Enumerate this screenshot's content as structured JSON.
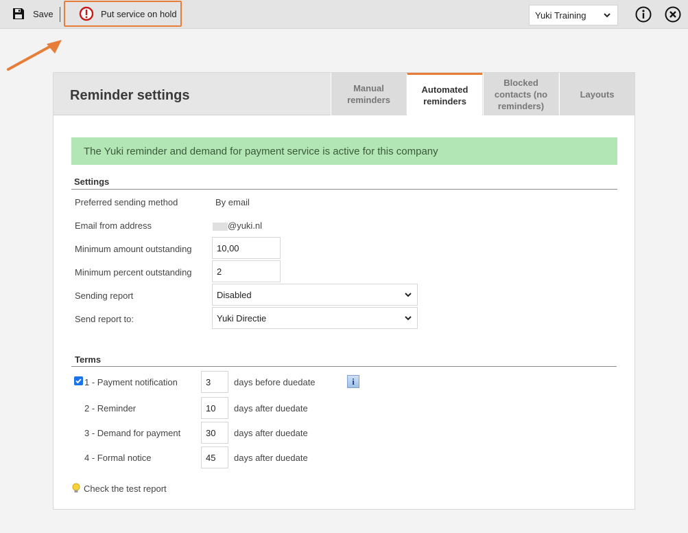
{
  "toolbar": {
    "save_label": "Save",
    "hold_label": "Put service on hold",
    "company": "Yuki Training",
    "accent_color": "#e67e3a"
  },
  "panel": {
    "title": "Reminder settings",
    "tabs": [
      {
        "label": "Manual reminders",
        "active": false
      },
      {
        "label": "Automated reminders",
        "active": true
      },
      {
        "label": "Blocked contacts (no reminders)",
        "active": false
      },
      {
        "label": "Layouts",
        "active": false
      }
    ],
    "status_banner": "The Yuki reminder and demand for payment service is active for this company"
  },
  "settings": {
    "section_title": "Settings",
    "preferred_sending_method_label": "Preferred sending method",
    "preferred_sending_method_value": "By email",
    "email_from_label": "Email from address",
    "email_from_value": "@yuki.nl",
    "min_amount_label": "Minimum amount outstanding",
    "min_amount_value": "10,00",
    "min_percent_label": "Minimum percent outstanding",
    "min_percent_value": "2",
    "sending_report_label": "Sending report",
    "sending_report_value": "Disabled",
    "send_report_to_label": "Send report to:",
    "send_report_to_value": "Yuki Directie"
  },
  "terms": {
    "section_title": "Terms",
    "items": [
      {
        "label": "1 - Payment notification",
        "days": "3",
        "suffix": "days before duedate",
        "checked": true
      },
      {
        "label": "2 - Reminder",
        "days": "10",
        "suffix": "days after duedate"
      },
      {
        "label": "3 - Demand for payment",
        "days": "30",
        "suffix": "days after duedate"
      },
      {
        "label": "4 - Formal notice",
        "days": "45",
        "suffix": "days after duedate"
      }
    ],
    "info_icon_glyph": "i"
  },
  "footer": {
    "test_report_label": "Check the test report"
  }
}
